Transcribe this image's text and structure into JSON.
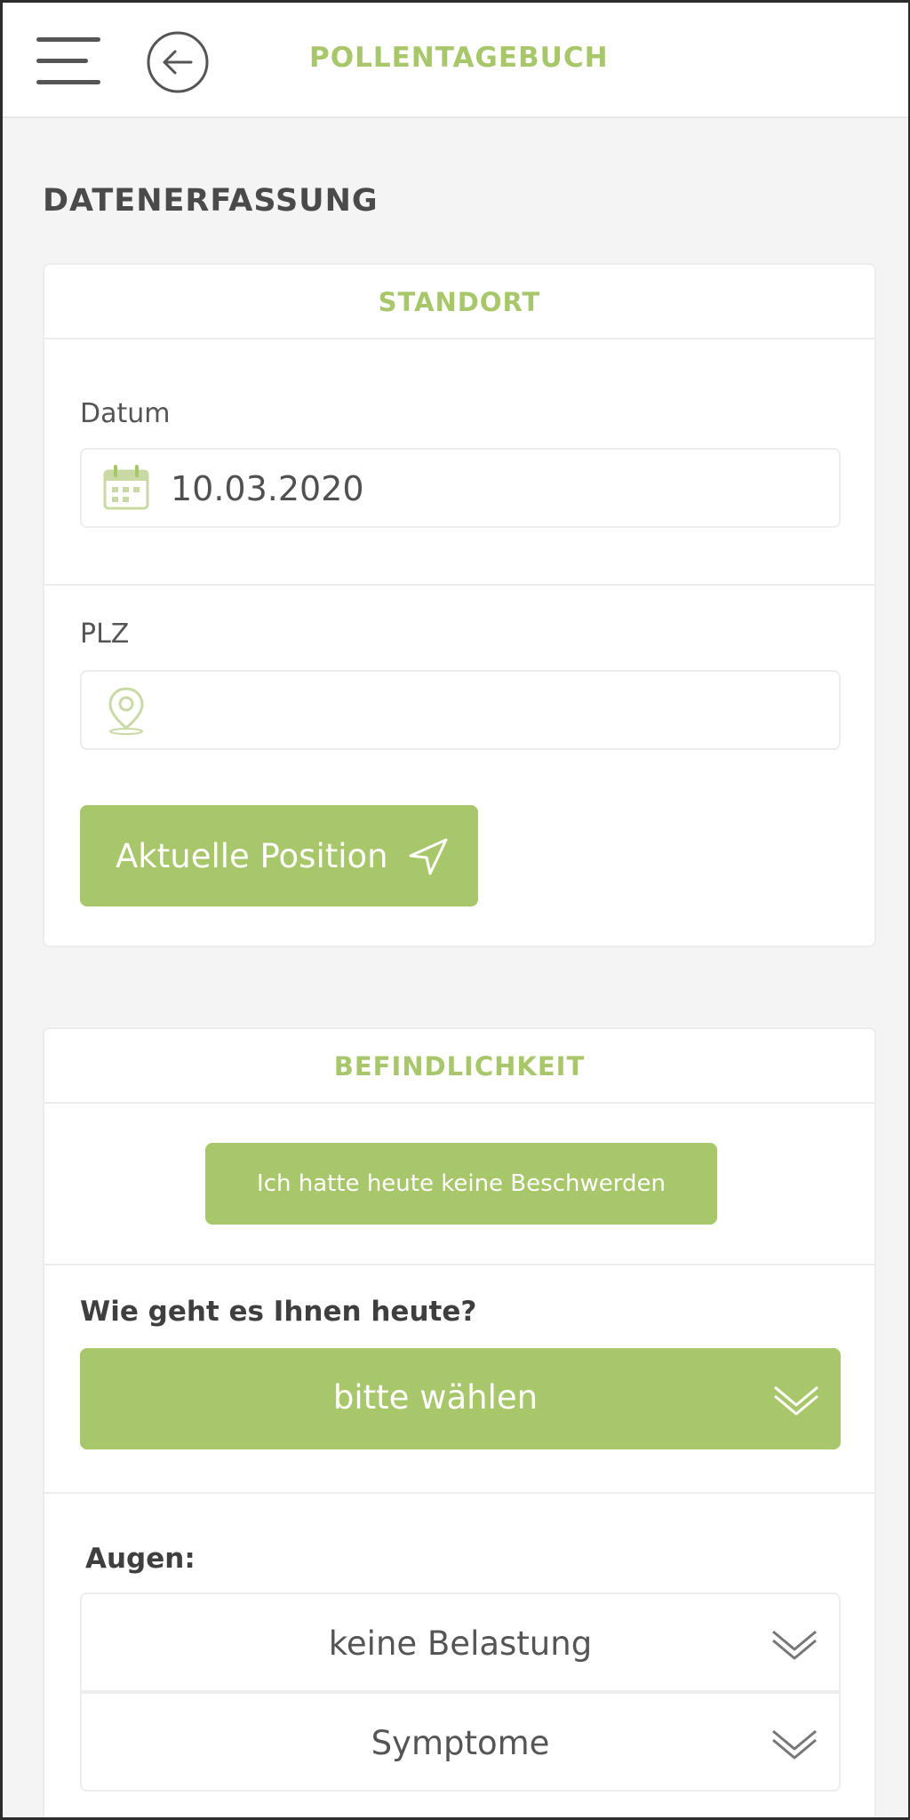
{
  "header": {
    "menu_icon": "hamburger-menu-icon",
    "back_icon": "arrow-left-circle-icon",
    "title": "POLLENTAGEBUCH"
  },
  "page": {
    "section_title": "DATENERFASSUNG"
  },
  "standort": {
    "heading": "STANDORT",
    "date_label": "Datum",
    "date_value": "10.03.2020",
    "date_icon": "calendar-icon",
    "plz_label": "PLZ",
    "plz_value": "",
    "plz_icon": "location-pin-icon",
    "position_button": "Aktuelle Position",
    "position_icon": "navigation-arrow-icon"
  },
  "befindlichkeit": {
    "heading": "BEFINDLICHKEIT",
    "no_complaints_button": "Ich hatte heute keine Beschwerden",
    "question": "Wie geht es Ihnen heute?",
    "mood_select": "bitte wählen",
    "eyes_label": "Augen:",
    "eyes_level_select": "keine Belastung",
    "eyes_symptoms_select": "Symptome"
  },
  "colors": {
    "accent": "#a8c76a",
    "text": "#555555",
    "background": "#f4f4f4"
  }
}
